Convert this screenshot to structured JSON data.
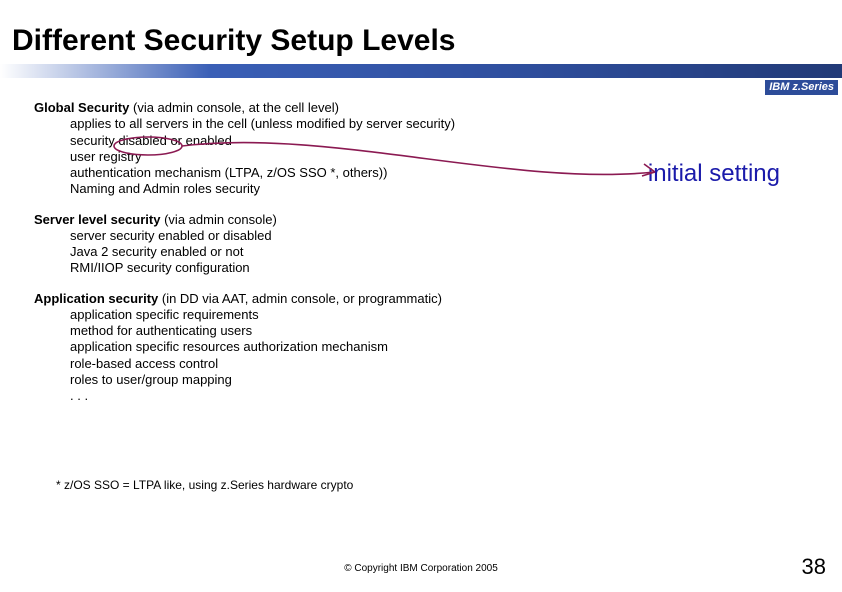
{
  "title": "Different Security Setup Levels",
  "ibm_tag": "IBM z.Series",
  "annotation": "initial setting",
  "sections": [
    {
      "head": "Global Security",
      "tail": " (via admin console, at the cell level)",
      "items": [
        "applies to all servers in the cell (unless modified by server security)",
        "security disabled or enabled",
        "user registry",
        "authentication mechanism (LTPA, z/OS SSO *, others))",
        "Naming and Admin roles security"
      ]
    },
    {
      "head": "Server level security",
      "tail": " (via admin console)",
      "items": [
        "server security enabled or disabled",
        "Java 2 security enabled or not",
        "RMI/IIOP security configuration"
      ]
    },
    {
      "head": "Application security",
      "tail": " (in DD via AAT, admin console, or programmatic)",
      "items": [
        "application specific requirements",
        "method for authenticating users",
        "application specific resources authorization mechanism",
        "role-based access control",
        "roles to user/group mapping",
        ". . ."
      ]
    }
  ],
  "footnote": "* z/OS SSO = LTPA like, using z.Series hardware crypto",
  "copyright": "© Copyright IBM Corporation 2005",
  "page": "38",
  "colors": {
    "arrow": "#8b1a52"
  }
}
